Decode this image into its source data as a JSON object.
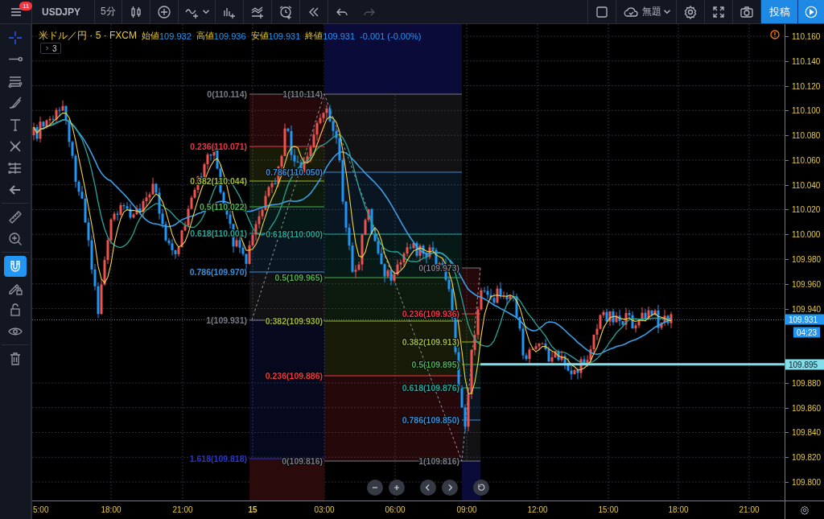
{
  "top_bar": {
    "menu_badge": "11",
    "symbol": "USDJPY",
    "interval": "5分",
    "history_buttons": [
      {
        "disabled": false
      },
      {
        "disabled": true
      }
    ],
    "layout_name": "無題",
    "publish_button": "投稿"
  },
  "legend": {
    "title": "米ドル／円 · 5 · FXCM",
    "fields": [
      {
        "label": "始値",
        "value": "109.932"
      },
      {
        "label": "高値",
        "value": "109.936"
      },
      {
        "label": "安値",
        "value": "109.931"
      },
      {
        "label": "終値",
        "value": "109.931"
      }
    ],
    "change": "-0.001 (-0.00%)",
    "indicators_count": "3"
  },
  "left_toolbar": {
    "tools": [
      {
        "selected": true,
        "on": false
      },
      {
        "selected": false,
        "on": false
      },
      {
        "selected": false,
        "on": false
      },
      {
        "selected": false,
        "on": false
      },
      {
        "selected": false,
        "on": false
      },
      {
        "selected": false,
        "on": false
      },
      {
        "selected": false,
        "on": false
      },
      {
        "selected": false,
        "on": false
      },
      {
        "selected": false,
        "on": false
      },
      {
        "selected": false,
        "on": false
      },
      {
        "selected": false,
        "on": true
      },
      {
        "selected": false,
        "on": false
      },
      {
        "selected": false,
        "on": false
      },
      {
        "selected": false,
        "on": false
      },
      {
        "selected": false,
        "on": false
      }
    ]
  },
  "chart": {
    "fib_retracements": [
      {
        "levels": [
          {
            "label": "0(110.114)",
            "color": "#787b86"
          },
          {
            "label": "0.236(110.071)",
            "color": "#f23645"
          },
          {
            "label": "0.382(110.044)",
            "color": "#9fb832"
          },
          {
            "label": "0.5(110.022)",
            "color": "#4caf50"
          },
          {
            "label": "0.618(110.001)",
            "color": "#26a69a"
          },
          {
            "label": "0.786(109.970)",
            "color": "#3d8ed6"
          },
          {
            "label": "1(109.931)",
            "color": "#787b86"
          },
          {
            "label": "1.618(109.818)",
            "color": "#2b37c9"
          }
        ]
      },
      {
        "levels": [
          {
            "label": "1(110.114)",
            "color": "#787b86"
          },
          {
            "label": "0.786(110.050)",
            "color": "#3d8ed6"
          },
          {
            "label": "0.618(110.000)",
            "color": "#26a69a"
          },
          {
            "label": "0.5(109.965)",
            "color": "#4caf50"
          },
          {
            "label": "0.382(109.930)",
            "color": "#9fb832"
          },
          {
            "label": "0.236(109.886)",
            "color": "#f23645"
          },
          {
            "label": "0(109.816)",
            "color": "#787b86"
          }
        ]
      },
      {
        "levels": [
          {
            "label": "0(109.973)",
            "color": "#787b86"
          },
          {
            "label": "0.236(109.936)",
            "color": "#f23645"
          },
          {
            "label": "0.382(109.913)",
            "color": "#9fb832"
          },
          {
            "label": "0.5(109.895)",
            "color": "#4caf50"
          },
          {
            "label": "0.618(109.876)",
            "color": "#26a69a"
          },
          {
            "label": "0.786(109.850)",
            "color": "#3d8ed6"
          },
          {
            "label": "1(109.816)",
            "color": "#787b86"
          }
        ]
      }
    ],
    "price_axis": {
      "labels": [
        "110.160",
        "110.140",
        "110.120",
        "110.100",
        "110.080",
        "110.060",
        "110.040",
        "110.020",
        "110.000",
        "109.980",
        "109.960",
        "109.940",
        "109.880",
        "109.860",
        "109.840",
        "109.820",
        "109.800"
      ],
      "last_price": "109.931",
      "countdown": "04:23",
      "line_price": "109.895"
    },
    "time_axis": {
      "labels": [
        {
          "text": "5:00",
          "kind": "time"
        },
        {
          "text": "18:00",
          "kind": "time"
        },
        {
          "text": "21:00",
          "kind": "time"
        },
        {
          "text": "15",
          "kind": "day"
        },
        {
          "text": "03:00",
          "kind": "time"
        },
        {
          "text": "06:00",
          "kind": "time"
        },
        {
          "text": "09:00",
          "kind": "time"
        },
        {
          "text": "12:00",
          "kind": "time"
        },
        {
          "text": "15:00",
          "kind": "time"
        },
        {
          "text": "18:00",
          "kind": "time"
        },
        {
          "text": "21:00",
          "kind": "time"
        }
      ]
    }
  }
}
